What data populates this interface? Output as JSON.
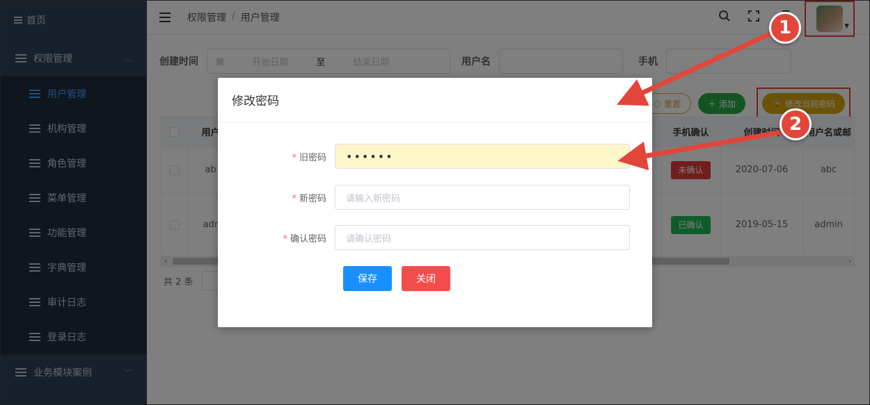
{
  "sidebar": {
    "home": "首页",
    "group_main": "权限管理",
    "items": [
      "用户管理",
      "机构管理",
      "角色管理",
      "菜单管理",
      "功能管理",
      "字典管理",
      "审计日志",
      "登录日志"
    ],
    "group_other": "业务模块案例"
  },
  "navbar": {
    "breadcrumb": [
      "权限管理",
      "用户管理"
    ]
  },
  "search": {
    "created_label": "创建时间",
    "start_placeholder": "开始日期",
    "range_sep": "至",
    "end_placeholder": "结束日期",
    "username_label": "用户名",
    "phone_label": "手机"
  },
  "actions": {
    "reset": "重置",
    "add": "添加",
    "change_pwd": "修改当前密码"
  },
  "table": {
    "headers": {
      "user": "用户",
      "phone_confirm": "手机确认",
      "created": "创建时间",
      "user_or_email": "用户名或邮"
    },
    "rows": [
      {
        "user": "ab",
        "status": "未确认",
        "date": "2020-07-06",
        "name": "abc"
      },
      {
        "user": "adr",
        "status": "已确认",
        "date": "2019-05-15",
        "name": "admin"
      }
    ]
  },
  "pager": {
    "total": "共 2 条"
  },
  "dialog": {
    "title": "修改密码",
    "old_label": "旧密码",
    "old_value": "••••••",
    "new_label": "新密码",
    "new_placeholder": "请输入新密码",
    "confirm_label": "确认密码",
    "confirm_placeholder": "请确认密码",
    "save": "保存",
    "close": "关闭"
  },
  "annotations": {
    "step1": "1",
    "step2": "2"
  },
  "colors": {
    "sidebar": "#304156",
    "active": "#409eff",
    "annotation": "#e2463b",
    "save": "#1890ff",
    "close": "#f44c4c"
  }
}
